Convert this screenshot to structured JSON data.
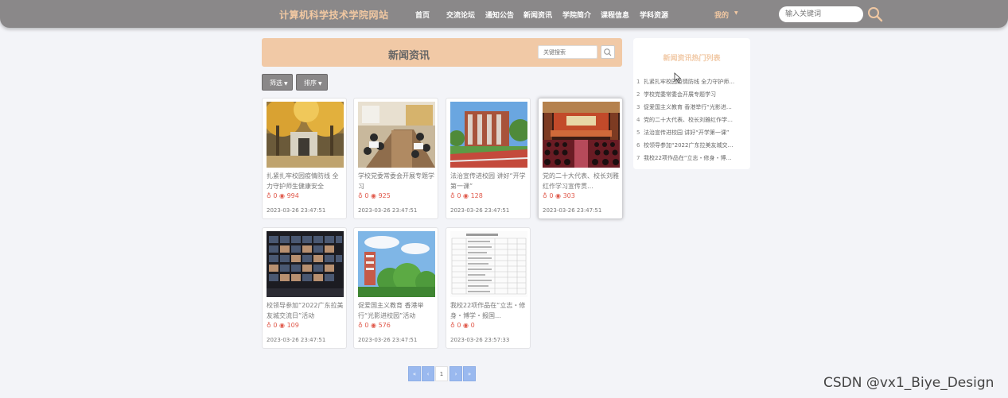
{
  "header": {
    "site_title": "计算机科学技术学院网站",
    "nav": [
      "首页",
      "交流论坛",
      "通知公告",
      "新闻资讯",
      "学院简介",
      "课程信息",
      "学科资源"
    ],
    "mine": "我的",
    "search_placeholder": "输入关键词"
  },
  "main": {
    "title": "新闻资讯",
    "keyword_placeholder": "关键搜索",
    "filter_label": "筛选",
    "sort_label": "排序",
    "cards": [
      {
        "title": "扎紧扎牢校园疫情防线 全力守护师生健康安全",
        "likes": "0",
        "views": "994",
        "time": "2023-03-26 23:47:51"
      },
      {
        "title": "学校党委常委会开展专题学习",
        "likes": "0",
        "views": "925",
        "time": "2023-03-26 23:47:51"
      },
      {
        "title": "法治宣传进校园 讲好“开学第一课”",
        "likes": "0",
        "views": "128",
        "time": "2023-03-26 23:47:51"
      },
      {
        "title": "党的二十大代表、校长刘雅红作学习宣传贯…",
        "likes": "0",
        "views": "303",
        "time": "2023-03-26 23:47:51"
      },
      {
        "title": "校领导参加“2022广东拉美友城交流日”活动",
        "likes": "0",
        "views": "109",
        "time": "2023-03-26 23:47:51"
      },
      {
        "title": "促爱国主义教育 香港举行“光影进校园”活动",
        "likes": "0",
        "views": "576",
        "time": "2023-03-26 23:47:51"
      },
      {
        "title": "我校22项作品在“立志・修身・博学・报国…",
        "likes": "0",
        "views": "0",
        "time": "2023-03-26 23:57:33"
      }
    ],
    "pager": [
      "«",
      "‹",
      "1",
      "›",
      "»"
    ]
  },
  "hot": {
    "title": "新闻资讯热门列表",
    "items": [
      {
        "num": "1",
        "text": "扎紧扎牢校园疫情防线 全力守护师…"
      },
      {
        "num": "2",
        "text": "学校党委常委会开展专题学习"
      },
      {
        "num": "3",
        "text": "促爱国主义教育 香港举行“光影进…"
      },
      {
        "num": "4",
        "text": "党的二十大代表、校长刘雅红作学…"
      },
      {
        "num": "5",
        "text": "法治宣传进校园 讲好“开学第一课”"
      },
      {
        "num": "6",
        "text": "校领导参加“2022广东拉美友城交…"
      },
      {
        "num": "7",
        "text": "我校22项作品在“立志・修身・博…"
      }
    ]
  },
  "watermark": "CSDN @vx1_Biye_Design",
  "colors": {
    "nav_bg": "#8a8889",
    "accent": "#f1c9a6",
    "stat": "#e0584a",
    "pager": "#9ab9ef"
  }
}
